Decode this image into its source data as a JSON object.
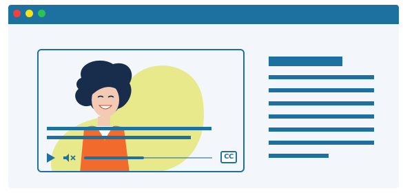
{
  "window": {
    "controls": [
      "close",
      "minimize",
      "maximize"
    ]
  },
  "colors": {
    "titlebar": "#1d71a0",
    "window_bg": "#f3f6fa",
    "close": "#f0413c",
    "minimize": "#f4e21c",
    "maximize": "#29c253",
    "accent": "#1d71a0",
    "blob": "#e8e98a",
    "hair": "#172d4b",
    "skin": "#f3cab4",
    "shirt": "#f26a2c"
  },
  "video_player": {
    "subtitle_lines": 2,
    "progress_fraction": 0.47,
    "muted": true,
    "icons": {
      "play": "play-icon",
      "mute": "speaker-muted-icon",
      "captions": "cc-icon"
    },
    "cc_label": "CC"
  },
  "text_panel": {
    "heading_lines": 1,
    "body_lines": 7
  }
}
